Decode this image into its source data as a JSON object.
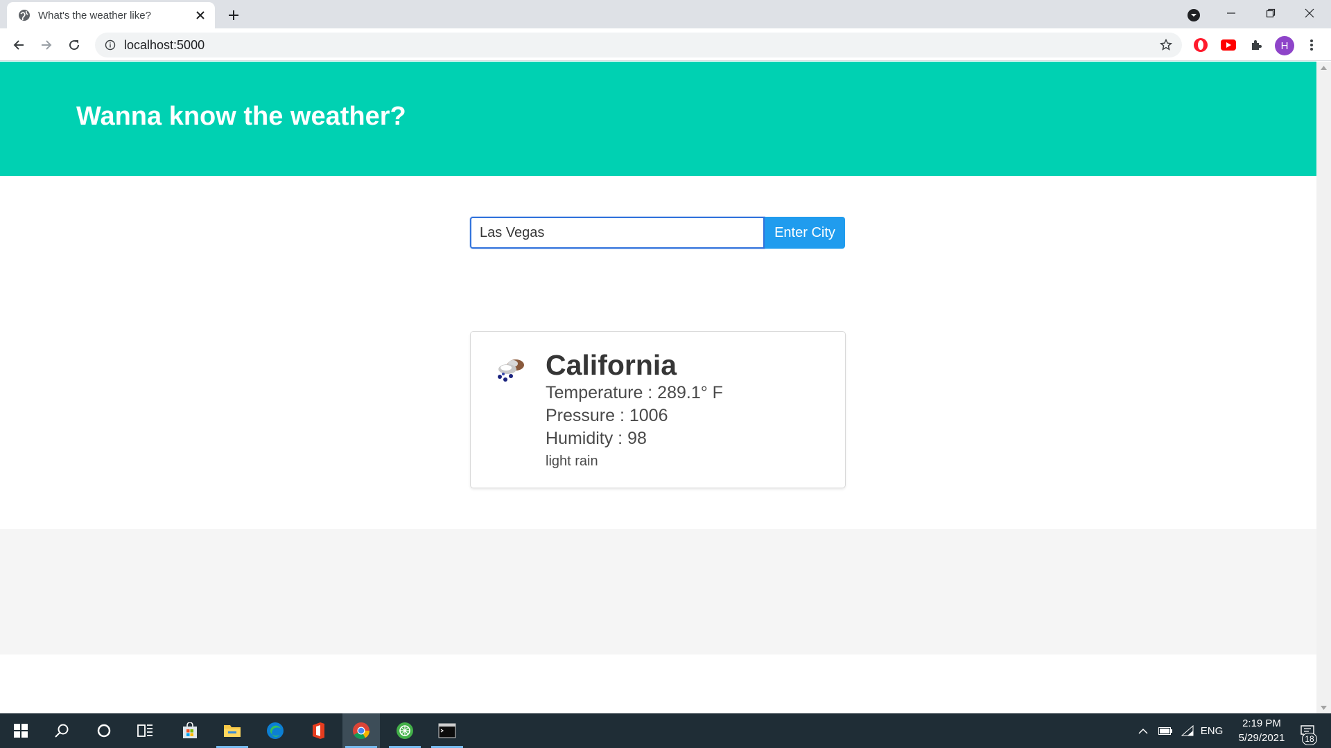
{
  "browser": {
    "tab": {
      "title": "What's the weather like?",
      "favicon": "globe-icon"
    },
    "url": "localhost:5000",
    "profile_initial": "H"
  },
  "page": {
    "hero_title": "Wanna know the weather?",
    "search": {
      "value": "Las Vegas",
      "button_label": "Enter City"
    },
    "weather_card": {
      "city": "California",
      "temperature": "Temperature : 289.1° F",
      "pressure": "Pressure : 1006",
      "humidity": "Humidity : 98",
      "description": "light rain",
      "icon": "rain-cloud-icon"
    }
  },
  "taskbar": {
    "language": "ENG",
    "time": "2:19 PM",
    "date": "5/29/2021",
    "notification_count": "18"
  },
  "colors": {
    "hero": "#00d1b2",
    "button": "#209cee",
    "input_border": "#3273dc",
    "footer": "#f5f5f5",
    "taskbar": "#1f2d36"
  }
}
